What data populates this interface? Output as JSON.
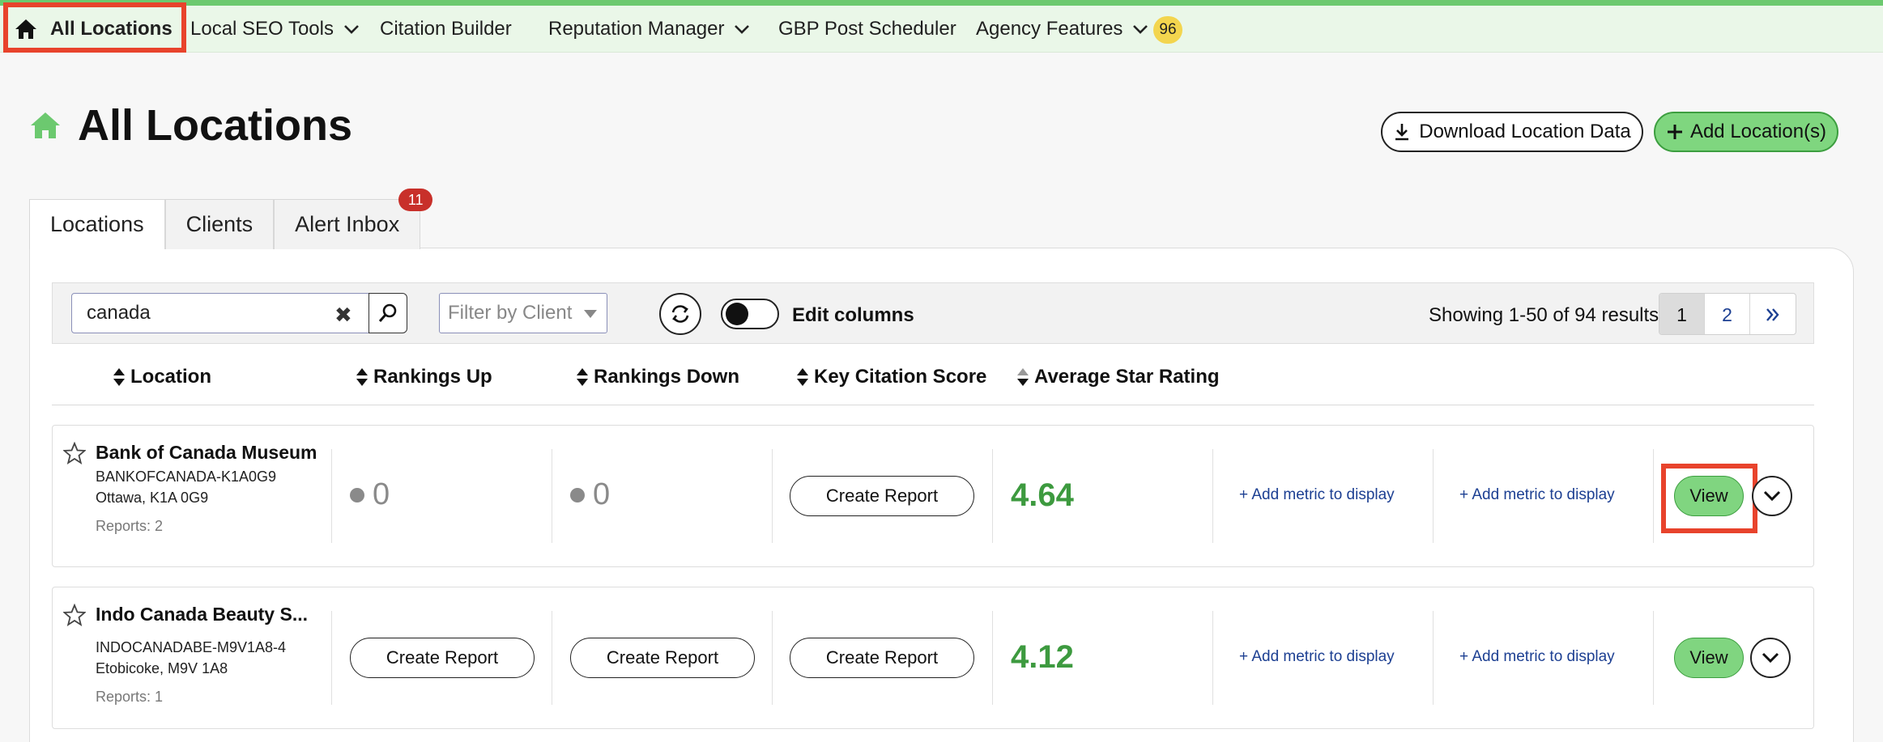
{
  "nav": {
    "home_label": "All Locations",
    "items": [
      {
        "label": "Local SEO Tools"
      },
      {
        "label": "Citation Builder"
      },
      {
        "label": "Reputation Manager"
      },
      {
        "label": "GBP Post Scheduler"
      },
      {
        "label": "Agency Features"
      }
    ],
    "agency_badge": "96"
  },
  "header": {
    "title": "All Locations",
    "download_label": "Download Location Data",
    "add_label": "Add Location(s)"
  },
  "tabs": [
    {
      "label": "Locations"
    },
    {
      "label": "Clients"
    },
    {
      "label": "Alert Inbox",
      "badge": "11"
    }
  ],
  "toolbar": {
    "search_value": "canada",
    "filter_placeholder": "Filter by Client",
    "edit_columns_label": "Edit columns",
    "showing_text": "Showing 1-50 of 94 results",
    "pages": [
      "1",
      "2"
    ]
  },
  "columns": [
    "Location",
    "Rankings Up",
    "Rankings Down",
    "Key Citation Score",
    "Average Star Rating"
  ],
  "rows": [
    {
      "name": "Bank of Canada Museum",
      "code": "BANKOFCANADA-K1A0G9",
      "city": "Ottawa, K1A 0G9",
      "reports": "Reports: 2",
      "rankings_up": "0",
      "rankings_down": "0",
      "citation_btn": "Create Report",
      "rating": "4.64",
      "metric1": "+ Add metric to display",
      "metric2": "+ Add metric to display",
      "view": "View"
    },
    {
      "name": "Indo Canada Beauty S...",
      "code": "INDOCANADABE-M9V1A8-4",
      "city": "Etobicoke, M9V 1A8",
      "reports": "Reports: 1",
      "rankings_up_btn": "Create Report",
      "rankings_down_btn": "Create Report",
      "citation_btn": "Create Report",
      "rating": "4.12",
      "metric1": "+ Add metric to display",
      "metric2": "+ Add metric to display",
      "view": "View"
    }
  ],
  "colors": {
    "accent_green": "#7fd67f",
    "rating_green": "#3d9a3f",
    "highlight_red": "#e8432c",
    "link_blue": "#1c3f92",
    "badge_red": "#c8302a",
    "badge_yellow": "#f3d54e"
  },
  "icons": [
    "home-icon",
    "chevron-down-icon",
    "download-icon",
    "plus-icon",
    "clear-icon",
    "search-icon",
    "refresh-icon",
    "sort-icon",
    "star-outline-icon",
    "double-chevron-right-icon"
  ]
}
